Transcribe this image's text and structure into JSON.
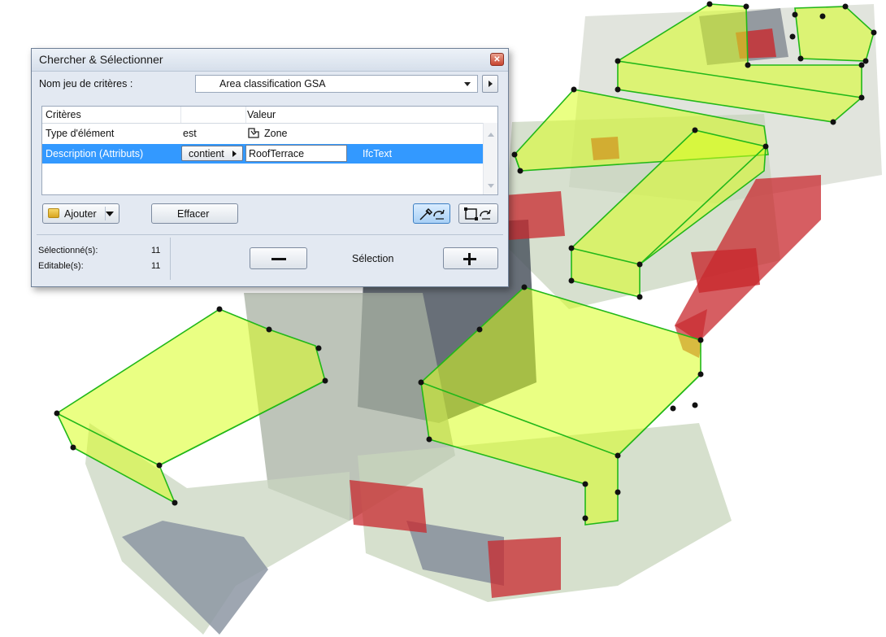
{
  "dialog": {
    "title": "Chercher & Sélectionner",
    "criteria_set_label": "Nom jeu de critères :",
    "criteria_set_value": "Area classification GSA",
    "columns": {
      "criteria": "Critères",
      "value": "Valeur"
    },
    "rows": [
      {
        "criterion": "Type d'élément",
        "operator": "est",
        "value": "Zone",
        "value_icon": "zone-icon"
      },
      {
        "criterion": "Description (Attributs)",
        "operator": "contient",
        "value": "RoofTerrace",
        "type": "IfcText"
      }
    ],
    "add_label": "Ajouter",
    "clear_label": "Effacer",
    "selected_label": "Sélectionné(s):",
    "selected_count": "11",
    "editable_label": "Editable(s):",
    "editable_count": "11",
    "selection_label": "Sélection",
    "colors": {
      "selection_row": "#3399ff",
      "zone_fill": "#d8ff1e",
      "zone_edge": "#22b819",
      "red_block": "#c8282d"
    }
  }
}
